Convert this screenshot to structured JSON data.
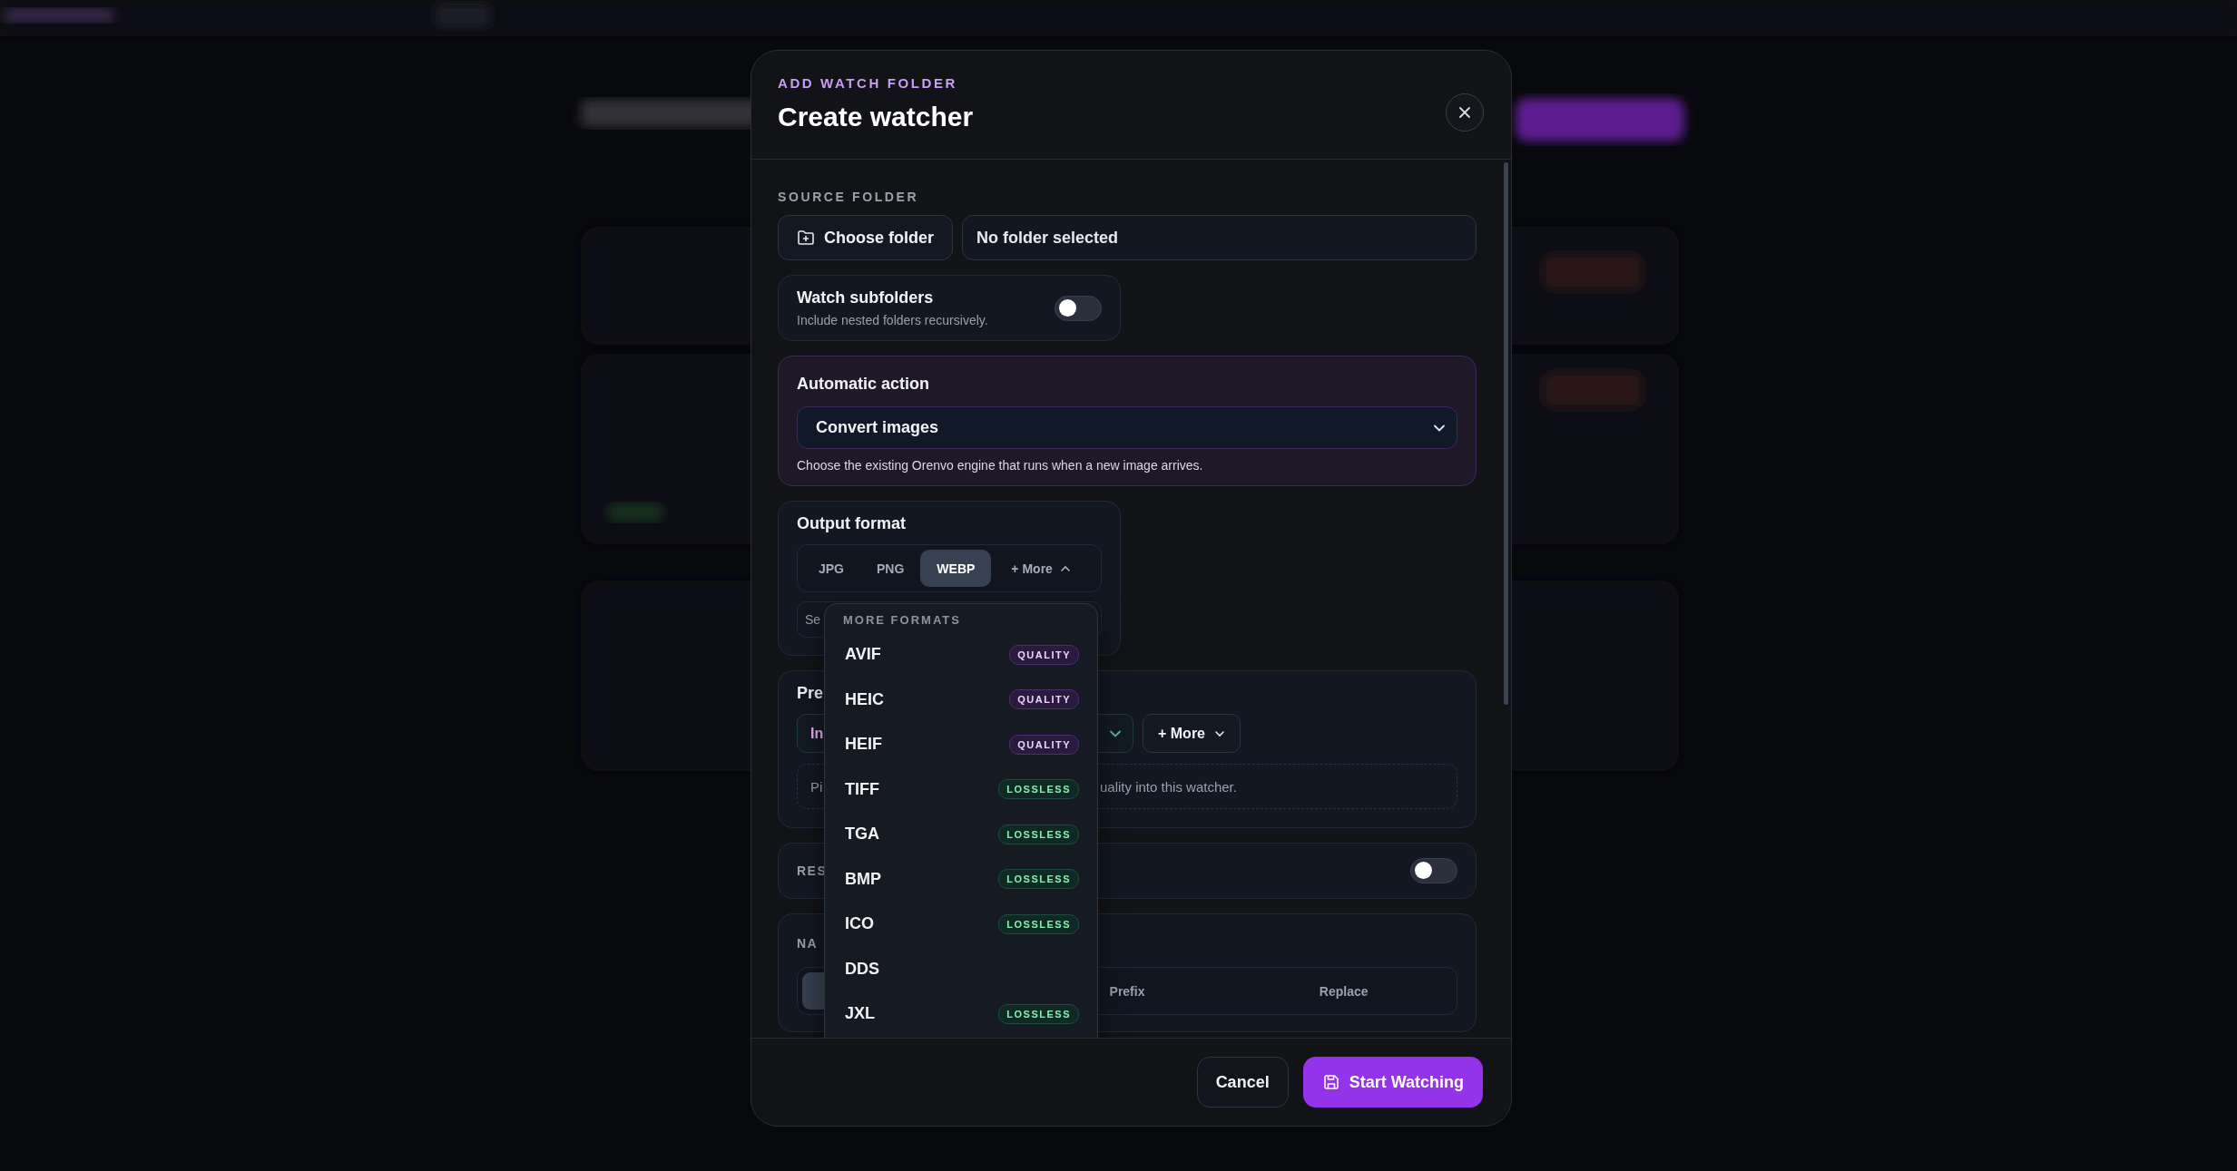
{
  "modal": {
    "eyebrow": "ADD WATCH FOLDER",
    "title": "Create watcher"
  },
  "source_folder": {
    "heading": "SOURCE FOLDER",
    "choose_button": "Choose folder",
    "path_field": {
      "value": "No folder selected"
    }
  },
  "watch_subfolders": {
    "label": "Watch subfolders",
    "hint": "Include nested folders recursively.",
    "on": false
  },
  "automatic_action": {
    "label": "Automatic action",
    "select_value": "Convert images",
    "help": "Choose the existing Orenvo engine that runs when a new image arrives."
  },
  "output_format": {
    "label": "Output format",
    "tabs": [
      {
        "label": "JPG",
        "selected": false,
        "kind": "format"
      },
      {
        "label": "PNG",
        "selected": false,
        "kind": "format"
      },
      {
        "label": "WEBP",
        "selected": true,
        "kind": "format"
      },
      {
        "label": "+ More",
        "selected": false,
        "kind": "more",
        "expanded": true
      }
    ],
    "field_fragment": "Se"
  },
  "more_formats_menu": {
    "heading": "MORE FORMATS",
    "items": [
      {
        "label": "AVIF",
        "badge": {
          "text": "QUALITY",
          "kind": "quality"
        }
      },
      {
        "label": "HEIC",
        "badge": {
          "text": "QUALITY",
          "kind": "quality"
        }
      },
      {
        "label": "HEIF",
        "badge": {
          "text": "QUALITY",
          "kind": "quality"
        }
      },
      {
        "label": "TIFF",
        "badge": {
          "text": "LOSSLESS",
          "kind": "lossless"
        }
      },
      {
        "label": "TGA",
        "badge": {
          "text": "LOSSLESS",
          "kind": "lossless"
        }
      },
      {
        "label": "BMP",
        "badge": {
          "text": "LOSSLESS",
          "kind": "lossless"
        }
      },
      {
        "label": "ICO",
        "badge": {
          "text": "LOSSLESS",
          "kind": "lossless"
        }
      },
      {
        "label": "DDS"
      },
      {
        "label": "JXL",
        "badge": {
          "text": "LOSSLESS",
          "kind": "lossless"
        }
      }
    ]
  },
  "presets": {
    "label_fragment": "Pre",
    "select_fragment": "In",
    "more_button": "+ More",
    "note_start": "Pi",
    "note_end": "uality into this watcher."
  },
  "resize": {
    "label_fragment": "RES",
    "on": false
  },
  "naming": {
    "label_fragment": "NA",
    "modes": [
      {
        "selected": true
      },
      {
        "label": "Prefix",
        "selected": false
      },
      {
        "label": "Replace",
        "selected": false
      }
    ]
  },
  "footer": {
    "cancel": "Cancel",
    "primary": "Start Watching"
  }
}
